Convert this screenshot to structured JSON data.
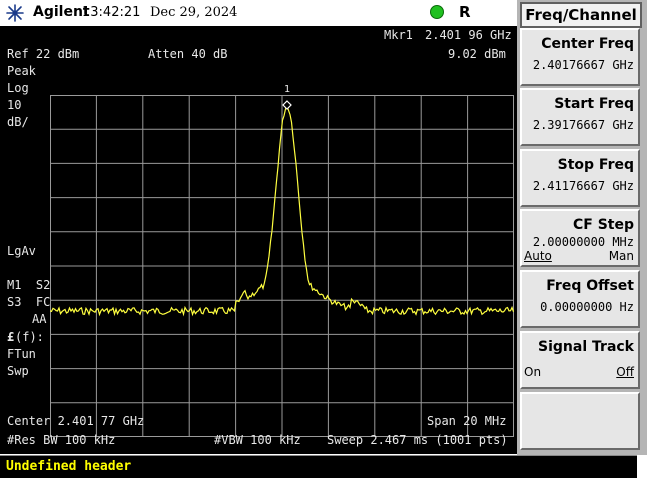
{
  "header": {
    "brand": "Agilent",
    "time": "13:42:21",
    "date": "Dec 29, 2024",
    "status_led_color": "#20c020",
    "remote_indicator": "R"
  },
  "screen": {
    "marker_readout_label": "Mkr1",
    "marker_freq": "2.401 96 GHz",
    "marker_amp": "9.02 dBm",
    "ref_level": "Ref 22 dBm",
    "atten": "Atten 40 dB",
    "left_annotations": [
      "Peak",
      "Log",
      "10",
      "dB/"
    ],
    "lgav": "LgAv",
    "m1s2": "M1  S2",
    "s3fc": "S3  FC",
    "aa": "AA",
    "ff": "(f):",
    "ff_symbol": "£",
    "ftun": "FTun",
    "swp": "Swp",
    "marker_number": "1",
    "center": "Center 2.401 77 GHz",
    "span": "Span 20 MHz",
    "rbw": "#Res BW 100 kHz",
    "vbw": "#VBW 100 kHz",
    "sweep": "Sweep 2.467 ms (1001 pts)",
    "trace_color": "#ffff40",
    "graticule_color": "#9a9a9a",
    "trace_icon": "spectrum-trace"
  },
  "message": "Undefined header",
  "panel": {
    "title": "Freq/Channel",
    "softkeys": [
      {
        "label": "Center Freq",
        "value": "2.40176667 GHz"
      },
      {
        "label": "Start Freq",
        "value": "2.39176667 GHz"
      },
      {
        "label": "Stop Freq",
        "value": "2.41176667 GHz"
      },
      {
        "label": "CF Step",
        "value": "2.00000000 MHz",
        "left": "Auto",
        "right": "Man"
      },
      {
        "label": "Freq Offset",
        "value": "0.00000000  Hz"
      },
      {
        "label": "Signal Track",
        "left": "On",
        "right": "Off"
      },
      {
        "label": ""
      }
    ]
  }
}
